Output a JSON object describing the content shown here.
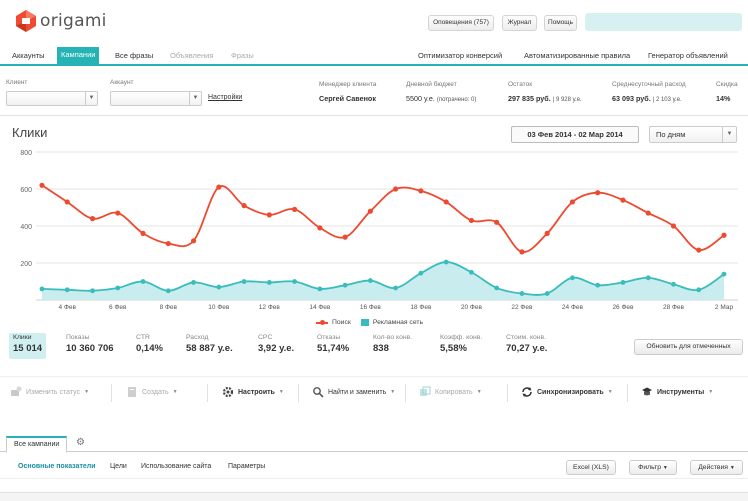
{
  "header": {
    "logo_text": "origami",
    "notifications_label": "Оповещения (757)",
    "journal_label": "Журнал",
    "help_label": "Помощь",
    "search_placeholder": ""
  },
  "main_tabs": [
    {
      "label": "Аккаунты",
      "state": "normal"
    },
    {
      "label": "Кампании",
      "state": "active"
    },
    {
      "label": "Все фразы",
      "state": "normal"
    },
    {
      "label": "Объявления",
      "state": "disabled"
    },
    {
      "label": "Фразы",
      "state": "disabled"
    }
  ],
  "right_links": [
    "Оптимизатор конверсий",
    "Автоматизированные правила",
    "Генератор объявлений"
  ],
  "filters": {
    "client_label": "Клиент",
    "account_label": "Аккаунт",
    "settings_link": "Настройки",
    "manager_label": "Менеджер клиента",
    "manager_value": "Сергей Савенок",
    "budget_label": "Дневной бюджет",
    "budget_value": "5500 у.е.",
    "budget_note": "(потрачено: 0)",
    "balance_label": "Остаток",
    "balance_value": "297 835 руб.",
    "balance_note": "| 9 928 у.е.",
    "avg_label": "Среднесуточный расход",
    "avg_value": "63 093 руб.",
    "avg_note": "| 2 103 у.е.",
    "discount_label": "Скидка",
    "discount_value": "14%"
  },
  "chart_header": {
    "title": "Клики",
    "date_range": "03 Фев 2014 - 02 Мар 2014",
    "period": "По дням"
  },
  "chart_data": {
    "type": "line",
    "title": "Клики",
    "ylim": [
      0,
      800
    ],
    "yticks": [
      200,
      400,
      600,
      800
    ],
    "x_labels": [
      "4 Фев",
      "6 Фев",
      "8 Фев",
      "10 Фев",
      "12 Фев",
      "14 Фев",
      "16 Фев",
      "18 Фев",
      "20 Фев",
      "22 Фев",
      "24 Фев",
      "26 Фев",
      "28 Фев",
      "2 Мар"
    ],
    "x": [
      "3 Фев",
      "4 Фев",
      "5 Фев",
      "6 Фев",
      "7 Фев",
      "8 Фев",
      "9 Фев",
      "10 Фев",
      "11 Фев",
      "12 Фев",
      "13 Фев",
      "14 Фев",
      "15 Фев",
      "16 Фев",
      "17 Фев",
      "18 Фев",
      "19 Фев",
      "20 Фев",
      "21 Фев",
      "22 Фев",
      "23 Фев",
      "24 Фев",
      "25 Фев",
      "26 Фев",
      "27 Фев",
      "28 Фев",
      "1 Мар",
      "2 Мар"
    ],
    "series": [
      {
        "name": "Поиск",
        "color": "#ee4a2f",
        "style": "line-markers",
        "values": [
          620,
          530,
          440,
          470,
          360,
          305,
          320,
          610,
          510,
          460,
          490,
          390,
          340,
          480,
          600,
          590,
          530,
          430,
          420,
          260,
          360,
          530,
          580,
          540,
          470,
          400,
          270,
          350
        ]
      },
      {
        "name": "Рекламная сеть",
        "color": "#39bcbc",
        "style": "area-markers",
        "values": [
          60,
          55,
          50,
          65,
          100,
          50,
          95,
          70,
          100,
          95,
          100,
          60,
          80,
          105,
          65,
          145,
          205,
          150,
          65,
          35,
          35,
          120,
          80,
          95,
          120,
          85,
          55,
          140
        ]
      }
    ],
    "legend_position": "bottom-center"
  },
  "legend": {
    "search": "Поиск",
    "network": "Рекламная сеть"
  },
  "stats": [
    {
      "label": "Клики",
      "value": "15 014",
      "selected": true
    },
    {
      "label": "Показы",
      "value": "10 360 706"
    },
    {
      "label": "CTR",
      "value": "0,14%"
    },
    {
      "label": "Расход",
      "value": "58 887 у.е."
    },
    {
      "label": "CPC",
      "value": "3,92 у.е."
    },
    {
      "label": "Отказы",
      "value": "51,74%"
    },
    {
      "label": "Кол-во конв.",
      "value": "838"
    },
    {
      "label": "Коэфф. конв.",
      "value": "5,58%"
    },
    {
      "label": "Стоим. конв.",
      "value": "70,27 у.е."
    }
  ],
  "update_button": "Обновить для отмеченных",
  "toolbar": [
    {
      "label": "Изменить статус",
      "icon": "status-icon",
      "enabled": false
    },
    {
      "label": "Создать",
      "icon": "create-icon",
      "enabled": false
    },
    {
      "label": "Настроить",
      "icon": "gear-icon",
      "enabled": true
    },
    {
      "label": "Найти и заменить",
      "icon": "search-icon",
      "enabled": true
    },
    {
      "label": "Копировать",
      "icon": "copy-icon",
      "enabled": false
    },
    {
      "label": "Синхронизировать",
      "icon": "sync-icon",
      "enabled": true
    },
    {
      "label": "Инструменты",
      "icon": "tools-icon",
      "enabled": true
    }
  ],
  "bottom_tabs": {
    "active": "Все кампании"
  },
  "subtabs": [
    "Основные показатели",
    "Цели",
    "Использование сайта",
    "Параметры"
  ],
  "bottom_buttons": {
    "excel": "Excel (XLS)",
    "filter": "Фильтр",
    "actions": "Действия"
  },
  "colors": {
    "accent": "#25b3b6",
    "search_line": "#ee4a2f",
    "network_area": "#39bcbc"
  }
}
